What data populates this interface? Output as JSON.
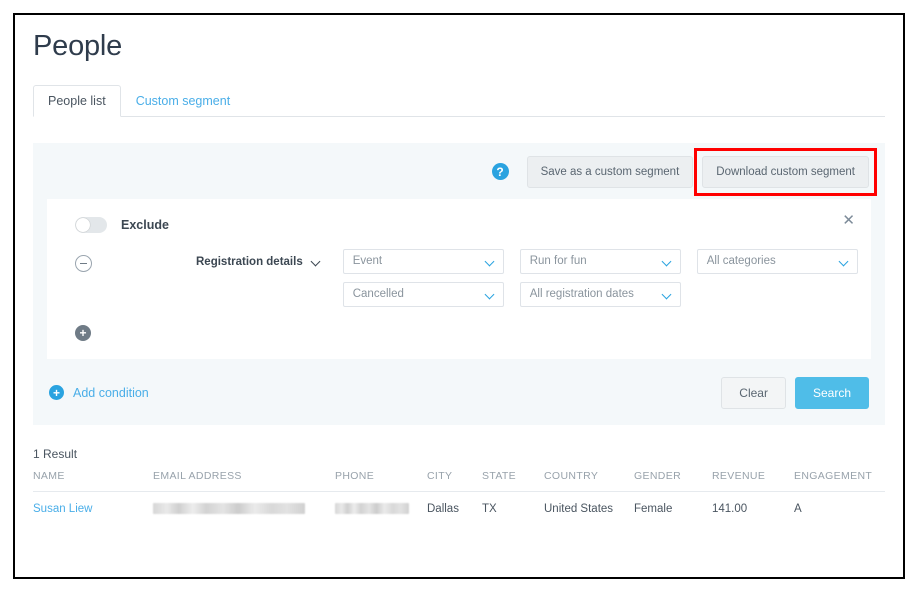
{
  "page": {
    "title": "People"
  },
  "tabs": [
    {
      "label": "People list",
      "active": true
    },
    {
      "label": "Custom segment",
      "active": false
    }
  ],
  "toolbar": {
    "help_icon": "help-circle-icon",
    "help_glyph": "?",
    "save_segment_label": "Save as a custom segment",
    "download_segment_label": "Download custom segment",
    "highlight_color": "#ff0000",
    "highlight_target": "Download custom segment"
  },
  "condition_card": {
    "exclude_label": "Exclude",
    "exclude_toggle_on": false,
    "close_glyph": "✕",
    "remove_glyph": "−",
    "add_glyph": "+",
    "field_label": "Registration details",
    "selects": [
      {
        "value": "Event",
        "row": 1
      },
      {
        "value": "Run for fun",
        "row": 1
      },
      {
        "value": "All categories",
        "row": 1
      },
      {
        "value": "Cancelled",
        "row": 2
      },
      {
        "value": "All registration dates",
        "row": 2
      }
    ]
  },
  "actions": {
    "add_condition_label": "Add condition",
    "add_condition_glyph": "+",
    "clear_label": "Clear",
    "search_label": "Search",
    "search_color": "#4fbde8"
  },
  "results": {
    "count_label": "1 Result",
    "columns": [
      "NAME",
      "EMAIL ADDRESS",
      "PHONE",
      "CITY",
      "STATE",
      "COUNTRY",
      "GENDER",
      "REVENUE",
      "ENGAGEMENT"
    ],
    "rows": [
      {
        "name": "Susan Liew",
        "email": "",
        "phone": "",
        "city": "Dallas",
        "state": "TX",
        "country": "United States",
        "gender": "Female",
        "revenue": "141.00",
        "engagement": "A"
      }
    ]
  }
}
